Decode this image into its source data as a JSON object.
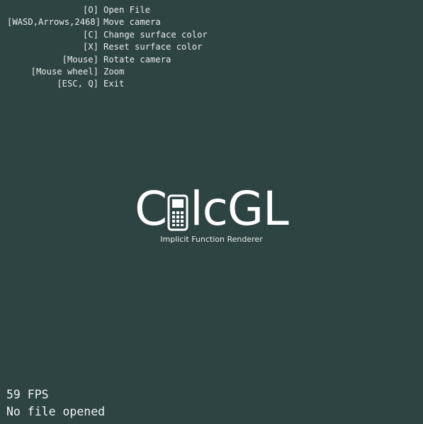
{
  "keymap": [
    {
      "key": "[O]",
      "action": "Open File"
    },
    {
      "key": "[WASD,Arrows,2468]",
      "action": "Move camera"
    },
    {
      "key": "[C]",
      "action": "Change surface color"
    },
    {
      "key": "[X]",
      "action": "Reset surface color"
    },
    {
      "key": "[Mouse]",
      "action": "Rotate camera"
    },
    {
      "key": "[Mouse wheel]",
      "action": "Zoom"
    },
    {
      "key": "[ESC, Q]",
      "action": "Exit"
    }
  ],
  "logo": {
    "prefix": "C",
    "suffix": "lcGL",
    "icon": "calculator-icon",
    "tagline": "Implicit Function Renderer"
  },
  "status": {
    "fps": "59 FPS",
    "file": "No file opened"
  },
  "colors": {
    "background": "#2e4442",
    "text": "#ffffff"
  }
}
